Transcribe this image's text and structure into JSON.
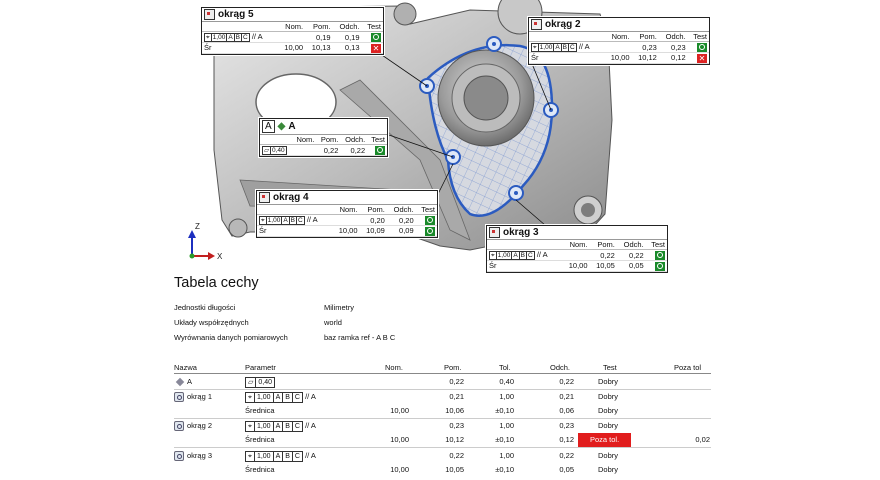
{
  "axes": {
    "z": "Z",
    "x": "X"
  },
  "callouts": {
    "c5": {
      "name": "okrąg 5",
      "h_nom": "Nom.",
      "h_pom": "Pom.",
      "h_odch": "Odch.",
      "h_test": "Test",
      "pos_ref": "// A",
      "pos_pom": "0,19",
      "pos_odch": "0,19",
      "tol": "1,00",
      "d1": "A",
      "d2": "B",
      "d3": "C",
      "sr": "Śr",
      "sr_nom": "10,00",
      "sr_pom": "10,13",
      "sr_odch": "0,13"
    },
    "c2": {
      "name": "okrąg 2",
      "h_nom": "Nom.",
      "h_pom": "Pom.",
      "h_odch": "Odch.",
      "h_test": "Test",
      "pos_ref": "// A",
      "pos_pom": "0,23",
      "pos_odch": "0,23",
      "tol": "1,00",
      "d1": "A",
      "d2": "B",
      "d3": "C",
      "sr": "Śr",
      "sr_nom": "10,00",
      "sr_pom": "10,12",
      "sr_odch": "0,12"
    },
    "cA": {
      "label": "A",
      "name": "A",
      "h_nom": "Nom.",
      "h_pom": "Pom.",
      "h_odch": "Odch.",
      "h_test": "Test",
      "flat_tol": "0,40",
      "pom": "0,22",
      "odch": "0,22"
    },
    "c4": {
      "name": "okrąg 4",
      "h_nom": "Nom.",
      "h_pom": "Pom.",
      "h_odch": "Odch.",
      "h_test": "Test",
      "pos_ref": "// A",
      "pos_pom": "0,20",
      "pos_odch": "0,20",
      "tol": "1,00",
      "d1": "A",
      "d2": "B",
      "d3": "C",
      "sr": "Śr",
      "sr_nom": "10,00",
      "sr_pom": "10,09",
      "sr_odch": "0,09"
    },
    "c3": {
      "name": "okrąg 3",
      "h_nom": "Nom.",
      "h_pom": "Pom.",
      "h_odch": "Odch.",
      "h_test": "Test",
      "pos_ref": "// A",
      "pos_pom": "0,22",
      "pos_odch": "0,22",
      "tol": "1,00",
      "d1": "A",
      "d2": "B",
      "d3": "C",
      "sr": "Śr",
      "sr_nom": "10,00",
      "sr_pom": "10,05",
      "sr_odch": "0,05"
    }
  },
  "report": {
    "title": "Tabela cechy",
    "info": [
      {
        "label": "Jednostki długości",
        "value": "Milimetry"
      },
      {
        "label": "Układy współrzędnych",
        "value": "world"
      },
      {
        "label": "Wyrównania danych pomiarowych",
        "value": "baz ramka ref - A B C"
      }
    ],
    "headers": {
      "nazwa": "Nazwa",
      "parametr": "Parametr",
      "nom": "Nom.",
      "pom": "Pom.",
      "tol": "Tol.",
      "odch": "Odch.",
      "test": "Test",
      "poza": "Poza tol"
    },
    "rows": [
      {
        "nazwa": "A",
        "param": "0,40",
        "nom": "",
        "pom": "0,22",
        "tol": "0,40",
        "odch": "0,22",
        "test": "Dobry",
        "poza": ""
      },
      {
        "nazwa": "okrąg 1",
        "param": "1,00",
        "ref": "// A",
        "nom": "",
        "pom": "0,21",
        "tol": "1,00",
        "odch": "0,21",
        "test": "Dobry",
        "poza": ""
      },
      {
        "nazwa": "",
        "param": "Średnica",
        "nom": "10,00",
        "pom": "10,06",
        "tol": "±0,10",
        "odch": "0,06",
        "test": "Dobry",
        "poza": ""
      },
      {
        "nazwa": "okrąg 2",
        "param": "1,00",
        "ref": "// A",
        "nom": "",
        "pom": "0,23",
        "tol": "1,00",
        "odch": "0,23",
        "test": "Dobry",
        "poza": ""
      },
      {
        "nazwa": "",
        "param": "Średnica",
        "nom": "10,00",
        "pom": "10,12",
        "tol": "±0,10",
        "odch": "0,12",
        "test": "Poza tol.",
        "poza": "0,02"
      },
      {
        "nazwa": "okrąg 3",
        "param": "1,00",
        "ref": "// A",
        "nom": "",
        "pom": "0,22",
        "tol": "1,00",
        "odch": "0,22",
        "test": "Dobry",
        "poza": ""
      },
      {
        "nazwa": "",
        "param": "Średnica",
        "nom": "10,00",
        "pom": "10,05",
        "tol": "±0,10",
        "odch": "0,05",
        "test": "Dobry",
        "poza": ""
      }
    ],
    "datums": [
      "A",
      "B",
      "C"
    ]
  }
}
